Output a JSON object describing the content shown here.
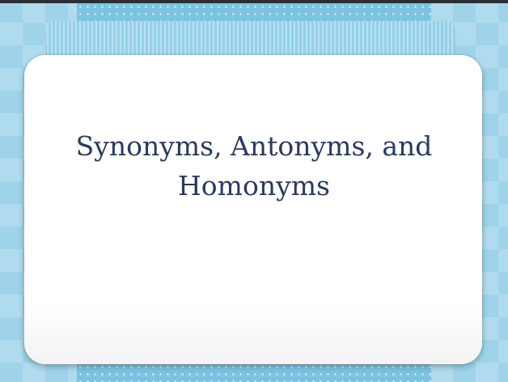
{
  "slide": {
    "title": "Synonyms, Antonyms, and Homonyms"
  },
  "colors": {
    "background": "#9fd3ea",
    "ribbon": "#94d0ea",
    "card": "#ffffff",
    "title_text": "#283b5e"
  }
}
